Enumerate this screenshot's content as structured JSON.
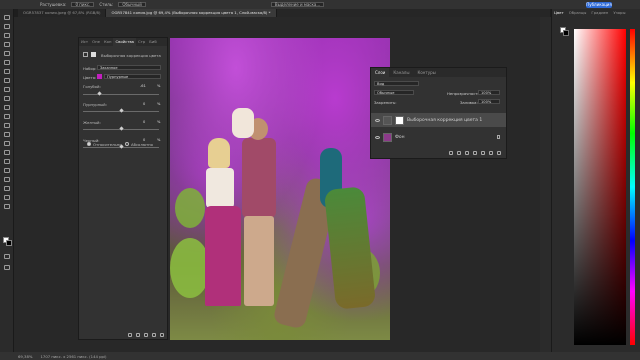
{
  "options_bar": {
    "feather_label": "Растушевка:",
    "feather_value": "0 пикс.",
    "style_label": "Стиль:",
    "style_value": "Обычный",
    "select_mask": "Выделение и маска...",
    "share_button": "Публикация"
  },
  "document_tabs": [
    {
      "label": "OGR57837 копия.jpeg @ 67,8% (RGB/8)",
      "active": false
    },
    {
      "label": "OGR57841 копия.jpg @ 69,4% (Выборочная коррекция цвета 1, Слой-маска/8) *",
      "active": true
    }
  ],
  "properties": {
    "tabs": [
      "Ист",
      "Опе",
      "Кон",
      "Свойства",
      "Стр",
      "Биб"
    ],
    "active_tab": "Свойства",
    "header": "Выборочная коррекция цвета",
    "preset_label": "Набор:",
    "preset_value": "Заказное",
    "colors_label": "Цвета:",
    "colors_value": "Пурпурные",
    "sliders": [
      {
        "label": "Голубой:",
        "value": "-61",
        "unit": "%",
        "level": -61
      },
      {
        "label": "Пурпурный:",
        "value": "0",
        "unit": "%",
        "level": 0
      },
      {
        "label": "Желтый:",
        "value": "0",
        "unit": "%",
        "level": 0
      },
      {
        "label": "Черный:",
        "value": "0",
        "unit": "%",
        "level": 0
      }
    ],
    "radio_relative": "Относительно",
    "radio_absolute": "Абсолютно"
  },
  "layers": {
    "tabs": [
      "Слои",
      "Каналы",
      "Контуры"
    ],
    "active_tab": "Слои",
    "filter": "Вид",
    "blend_mode": "Обычные",
    "opacity_label": "Непрозрачность:",
    "opacity_value": "100%",
    "lock_label": "Закрепить:",
    "fill_label": "Заливка:",
    "fill_value": "100%",
    "items": [
      {
        "name": "Выборочная коррекция цвета 1",
        "selected": true
      },
      {
        "name": "Фон",
        "selected": false
      }
    ]
  },
  "color_panel": {
    "tabs": [
      "Цвет",
      "Образцы",
      "Градиен",
      "Узоры"
    ],
    "active_tab": "Цвет"
  },
  "status": {
    "zoom": "69,38%",
    "doc_info": "1707 пикс. x 2561 пикс. (144 ppi)"
  },
  "colors": {
    "accent": "#2f6bd8",
    "magenta_swatch": "#c21fbf"
  }
}
